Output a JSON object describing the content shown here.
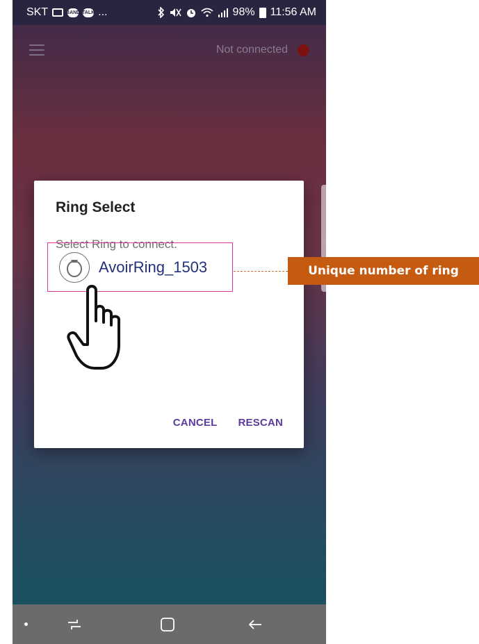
{
  "status_bar": {
    "carrier": "SKT",
    "notification_icons": [
      "mail-icon",
      "band-icon",
      "talk-icon"
    ],
    "more": "...",
    "battery": "98%",
    "time": "11:56 AM"
  },
  "app_bar": {
    "menu_icon": "hamburger-menu-icon",
    "connection_status": "Not connected",
    "connection_dot_color": "#7d1010"
  },
  "dialog": {
    "title": "Ring Select",
    "subtitle": "Select Ring to connect.",
    "device": {
      "icon": "ring-icon",
      "name": "AvoirRing_1503"
    },
    "cancel_label": "CANCEL",
    "rescan_label": "RESCAN",
    "accent_color": "#5b3aa0"
  },
  "annotation": {
    "callout_text": "Unique number of ring",
    "callout_color": "#c55a11",
    "highlight_color": "#d7399c",
    "pointer_icon": "pointing-hand-icon"
  },
  "nav_bar": {
    "items": [
      "dot-icon",
      "recent-apps-icon",
      "home-icon",
      "back-icon"
    ]
  }
}
